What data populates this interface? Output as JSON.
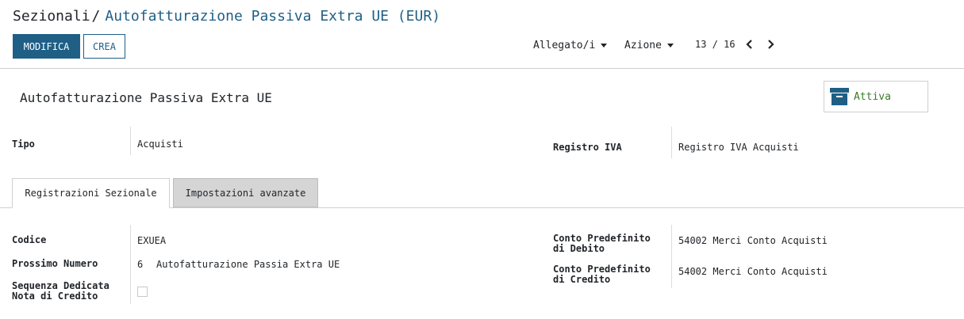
{
  "breadcrumb": {
    "parent": "Sezionali",
    "separator": "/",
    "current": "Autofatturazione Passiva Extra UE (EUR)"
  },
  "toolbar": {
    "edit_label": "MODIFICA",
    "create_label": "CREA",
    "attachments_label": "Allegato/i",
    "action_label": "Azione"
  },
  "pager": {
    "value": "13 / 16",
    "prev_icon": "chevron-left-icon",
    "next_icon": "chevron-right-icon"
  },
  "record": {
    "name": "Autofatturazione Passiva Extra UE",
    "active_button": {
      "label": "Attiva",
      "icon": "archive-icon"
    }
  },
  "fields_top": {
    "tipo_label": "Tipo",
    "tipo_value": "Acquisti",
    "registro_label": "Registro IVA",
    "registro_value": "Registro IVA Acquisti"
  },
  "tabs": [
    {
      "label": "Registrazioni Sezionale",
      "active": true
    },
    {
      "label": "Impostazioni avanzate",
      "active": false
    }
  ],
  "tab_fields": {
    "codice_label": "Codice",
    "codice_value": "EXUEA",
    "prossimo_label": "Prossimo Numero",
    "prossimo_number": "6",
    "prossimo_sequence": "Autofatturazione Passia Extra UE",
    "sequenza_label_1": "Sequenza Dedicata",
    "sequenza_label_2": "Nota di Credito",
    "sequenza_checked": false,
    "debito_label_1": "Conto Predefinito",
    "debito_label_2": "di Debito",
    "debito_value": "54002 Merci Conto Acquisti",
    "credito_label_1": "Conto Predefinito",
    "credito_label_2": "di Credito",
    "credito_value": "54002 Merci Conto Acquisti"
  },
  "colors": {
    "primary": "#1f5f86",
    "active_green": "#3c7a2a"
  }
}
